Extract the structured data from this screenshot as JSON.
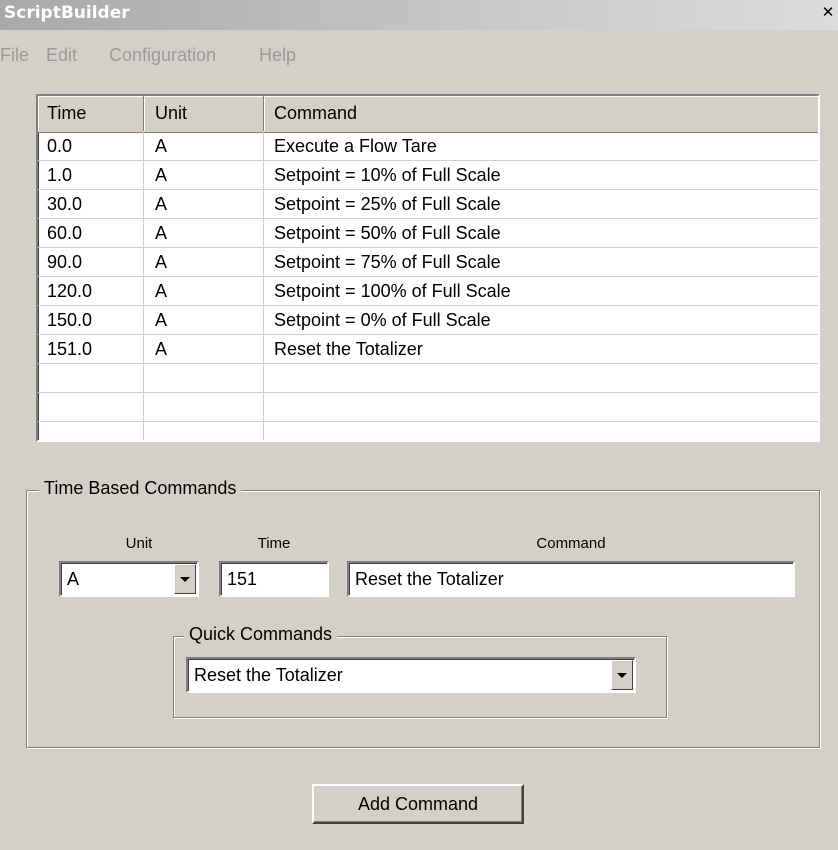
{
  "window": {
    "title": "ScriptBuilder"
  },
  "menu": [
    "File",
    "Edit",
    "Configuration",
    "Help"
  ],
  "table": {
    "columns": [
      "Time",
      "Unit",
      "Command"
    ],
    "rows": [
      [
        "0.0",
        "A",
        "Execute a Flow Tare"
      ],
      [
        "1.0",
        "A",
        "Setpoint = 10% of Full Scale"
      ],
      [
        "30.0",
        "A",
        "Setpoint = 25% of Full Scale"
      ],
      [
        "60.0",
        "A",
        "Setpoint = 50% of Full Scale"
      ],
      [
        "90.0",
        "A",
        "Setpoint = 75% of Full Scale"
      ],
      [
        "120.0",
        "A",
        "Setpoint = 100% of Full Scale"
      ],
      [
        "150.0",
        "A",
        "Setpoint = 0% of Full Scale"
      ],
      [
        "151.0",
        "A",
        "Reset the Totalizer"
      ],
      [
        "",
        "",
        ""
      ],
      [
        "",
        "",
        ""
      ],
      [
        "",
        "",
        ""
      ]
    ]
  },
  "time_based": {
    "group_title": "Time Based Commands",
    "unit_label": "Unit",
    "time_label": "Time",
    "command_label": "Command",
    "unit_value": "A",
    "time_value": "151",
    "command_value": "Reset the Totalizer"
  },
  "quick_commands": {
    "group_title": "Quick Commands",
    "selected": "Reset the Totalizer"
  },
  "add_button_label": "Add Command"
}
